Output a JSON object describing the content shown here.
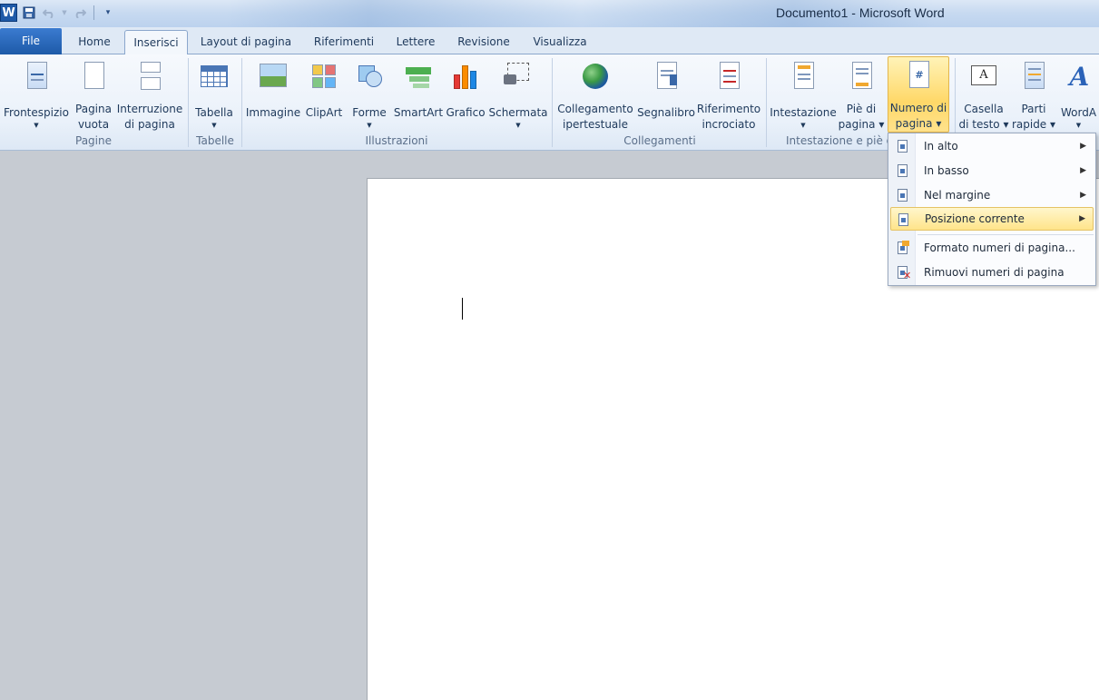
{
  "window": {
    "title": "Documento1 - Microsoft Word"
  },
  "qat": {
    "logo": "W"
  },
  "tabs": [
    {
      "label": "File"
    },
    {
      "label": "Home"
    },
    {
      "label": "Inserisci"
    },
    {
      "label": "Layout di pagina"
    },
    {
      "label": "Riferimenti"
    },
    {
      "label": "Lettere"
    },
    {
      "label": "Revisione"
    },
    {
      "label": "Visualizza"
    }
  ],
  "ribbon": {
    "groups": {
      "pagine": "Pagine",
      "tabelle": "Tabelle",
      "illustrazioni": "Illustrazioni",
      "collegamenti": "Collegamenti",
      "intestazione": "Intestazione e piè d"
    },
    "buttons": {
      "frontespizio": "Frontespizio",
      "pagina_vuota_1": "Pagina",
      "pagina_vuota_2": "vuota",
      "interruzione_1": "Interruzione",
      "interruzione_2": "di pagina",
      "tabella": "Tabella",
      "immagine": "Immagine",
      "clipart": "ClipArt",
      "forme": "Forme",
      "smartart": "SmartArt",
      "grafico": "Grafico",
      "schermata": "Schermata",
      "collegamento_1": "Collegamento",
      "collegamento_2": "ipertestuale",
      "segnalibro": "Segnalibro",
      "riferimento_1": "Riferimento",
      "riferimento_2": "incrociato",
      "intestazione": "Intestazione",
      "pie_1": "Piè di",
      "pie_2": "pagina",
      "numero_1": "Numero di",
      "numero_2": "pagina",
      "casella_1": "Casella",
      "casella_2": "di testo",
      "parti_1": "Parti",
      "parti_2": "rapide",
      "wordart": "WordA"
    }
  },
  "dropdown": {
    "items": [
      {
        "label": "In alto"
      },
      {
        "label": "In basso"
      },
      {
        "label": "Nel margine"
      },
      {
        "label": "Posizione corrente"
      },
      {
        "label": "Formato numeri di pagina..."
      },
      {
        "label": "Rimuovi numeri di pagina"
      }
    ]
  },
  "colors": {
    "file_tab": "#1e5aa8",
    "highlight": "#ffd868",
    "workspace": "#c6cbd2"
  }
}
